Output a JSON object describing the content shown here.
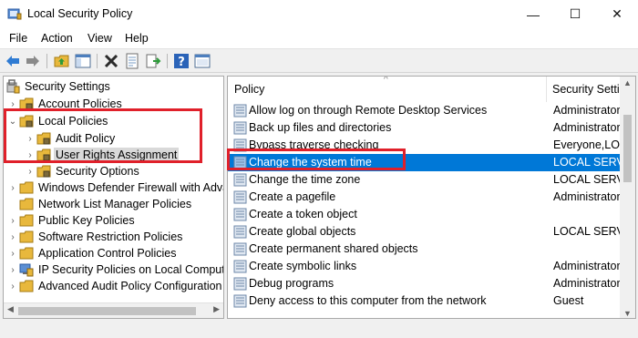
{
  "window": {
    "title": "Local Security Policy",
    "controls": {
      "minimize": "—",
      "maximize": "☐",
      "close": "✕"
    }
  },
  "menu": [
    "File",
    "Action",
    "View",
    "Help"
  ],
  "toolbar": {
    "icons": [
      "back-icon",
      "forward-icon",
      "up-folder-icon",
      "show-hide-tree-icon",
      "delete-icon",
      "properties-icon",
      "export-list-icon",
      "help-icon",
      "console-icon"
    ]
  },
  "tree": {
    "items": [
      {
        "label": "Security Settings",
        "level": 0,
        "expanded": true,
        "icon": "security-settings-icon"
      },
      {
        "label": "Account Policies",
        "level": 1,
        "expanded": false,
        "icon": "folder-icon"
      },
      {
        "label": "Local Policies",
        "level": 1,
        "expanded": true,
        "icon": "folder-icon"
      },
      {
        "label": "Audit Policy",
        "level": 2,
        "expanded": false,
        "icon": "folder-icon"
      },
      {
        "label": "User Rights Assignment",
        "level": 2,
        "expanded": false,
        "icon": "folder-icon",
        "selected": true
      },
      {
        "label": "Security Options",
        "level": 2,
        "expanded": false,
        "icon": "folder-icon"
      },
      {
        "label": "Windows Defender Firewall with Adva",
        "level": 1,
        "expanded": false,
        "icon": "folder-icon"
      },
      {
        "label": "Network List Manager Policies",
        "level": 1,
        "expanded": null,
        "icon": "folder-icon"
      },
      {
        "label": "Public Key Policies",
        "level": 1,
        "expanded": false,
        "icon": "folder-icon"
      },
      {
        "label": "Software Restriction Policies",
        "level": 1,
        "expanded": false,
        "icon": "folder-icon"
      },
      {
        "label": "Application Control Policies",
        "level": 1,
        "expanded": false,
        "icon": "folder-icon"
      },
      {
        "label": "IP Security Policies on Local Compute",
        "level": 1,
        "expanded": false,
        "icon": "ip-security-icon"
      },
      {
        "label": "Advanced Audit Policy Configuration",
        "level": 1,
        "expanded": false,
        "icon": "folder-icon"
      }
    ]
  },
  "list": {
    "columns": [
      "Policy",
      "Security Settin"
    ],
    "rows": [
      {
        "policy": "Allow log on through Remote Desktop Services",
        "setting": "Administrator"
      },
      {
        "policy": "Back up files and directories",
        "setting": "Administrator"
      },
      {
        "policy": "Bypass traverse checking",
        "setting": "Everyone,LOC"
      },
      {
        "policy": "Change the system time",
        "setting": "LOCAL SERVIC",
        "selected": true
      },
      {
        "policy": "Change the time zone",
        "setting": "LOCAL SERVIC"
      },
      {
        "policy": "Create a pagefile",
        "setting": "Administrator"
      },
      {
        "policy": "Create a token object",
        "setting": ""
      },
      {
        "policy": "Create global objects",
        "setting": "LOCAL SERVIC"
      },
      {
        "policy": "Create permanent shared objects",
        "setting": ""
      },
      {
        "policy": "Create symbolic links",
        "setting": "Administrator"
      },
      {
        "policy": "Debug programs",
        "setting": "Administrator"
      },
      {
        "policy": "Deny access to this computer from the network",
        "setting": "Guest"
      }
    ]
  },
  "colors": {
    "selection": "#0078d7",
    "highlight_box": "#e0202a",
    "folder": "#e8b83c"
  }
}
